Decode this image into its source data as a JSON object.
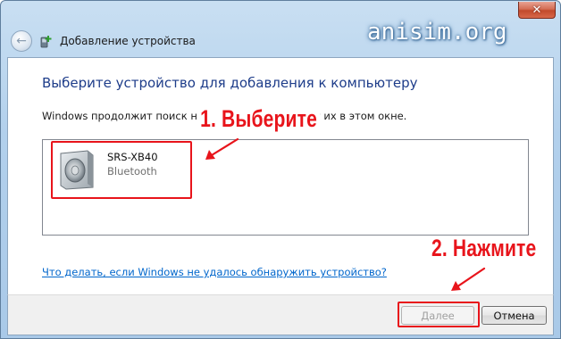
{
  "window": {
    "title": "Добавление устройства",
    "close_label": "✕"
  },
  "watermark": "anisim.org",
  "main": {
    "heading": "Выберите устройство для добавления к компьютеру",
    "subtext_left": "Windows продолжит поиск но",
    "subtext_right": "т их в этом окне.",
    "devices": [
      {
        "name": "SRS-XB40",
        "type": "Bluetooth",
        "icon": "speaker-icon"
      }
    ],
    "help_link": "Что делать, если Windows не удалось обнаружить устройство?"
  },
  "footer": {
    "next_label": "Далее",
    "cancel_label": "Отмена"
  },
  "annotations": {
    "step1": "1. Выберите",
    "step2": "2. Нажмите",
    "color": "#e8141b"
  }
}
